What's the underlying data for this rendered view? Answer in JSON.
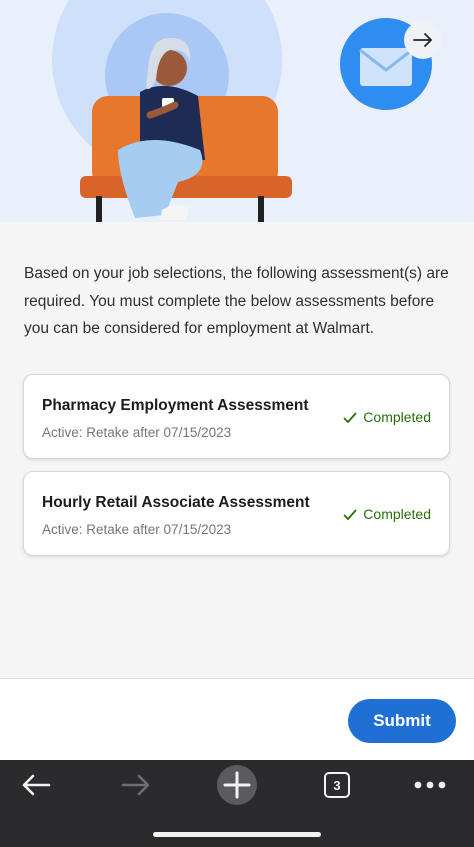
{
  "intro_text": "Based on your job selections, the following assessment(s) are required. You must complete the below assessments before you can be considered for employment at Walmart.",
  "assessments": [
    {
      "title": "Pharmacy Employment Assessment",
      "subtitle": "Active: Retake after 07/15/2023",
      "status": "Completed"
    },
    {
      "title": "Hourly Retail Associate Assessment",
      "subtitle": "Active: Retake after 07/15/2023",
      "status": "Completed"
    }
  ],
  "submit_label": "Submit",
  "browser": {
    "tab_count": "3"
  },
  "colors": {
    "accent": "#1f6fd4",
    "success": "#2a8703",
    "couch": "#e8772e",
    "toolbar": "#2b2b2d"
  },
  "icons": [
    "mail-icon",
    "arrow-right-icon",
    "check-icon",
    "back-icon",
    "forward-icon",
    "new-tab-icon",
    "tabs-icon",
    "more-icon"
  ]
}
